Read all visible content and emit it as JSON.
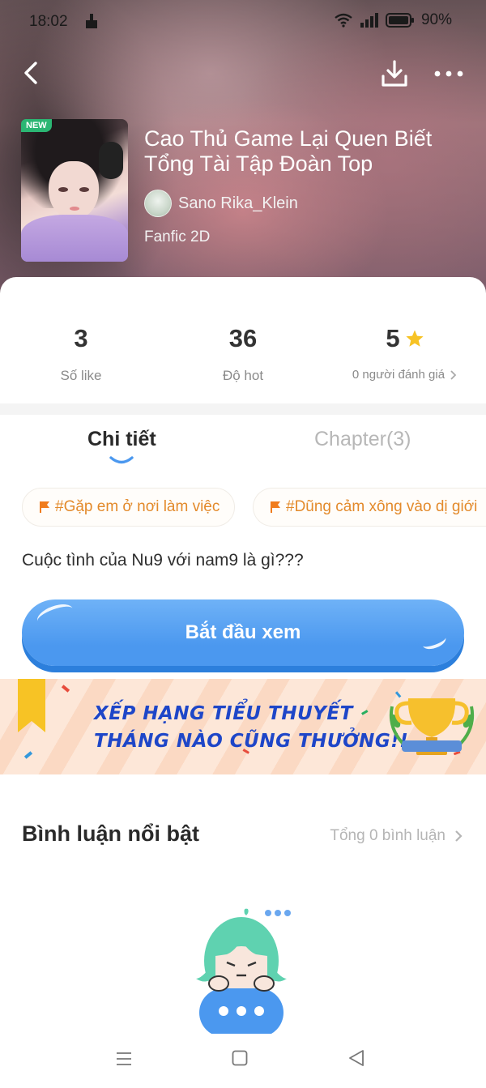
{
  "status_bar": {
    "time": "18:02",
    "battery": "90%"
  },
  "book": {
    "badge": "NEW",
    "title": "Cao Thủ Game Lại Quen Biết Tổng Tài Tập Đoàn Top",
    "author": "Sano Rika_Klein",
    "genre": "Fanfic 2D"
  },
  "stats": {
    "likes": {
      "value": "3",
      "label": "Số like"
    },
    "hot": {
      "value": "36",
      "label": "Độ hot"
    },
    "rating": {
      "value": "5",
      "label": "0 người đánh giá"
    }
  },
  "tabs": {
    "detail": "Chi tiết",
    "chapters": "Chapter(3)"
  },
  "tags": [
    "#Gặp em ở nơi làm việc",
    "#Dũng cảm xông vào dị giới"
  ],
  "description": "Cuộc tình của Nu9 với nam9 là gì???",
  "cta_label": "Bắt đầu xem",
  "banner": {
    "line1": "XẾP HẠNG TIỂU THUYẾT",
    "line2": "THÁNG NÀO CŨNG THƯỞNG!!"
  },
  "comments": {
    "title": "Bình luận nổi bật",
    "total": "Tổng 0 bình luận"
  },
  "colors": {
    "accent_blue": "#4b98ef",
    "tag_orange": "#e38a2b",
    "star": "#f7c325",
    "banner_text": "#1e46c8"
  },
  "icons": [
    "back-icon",
    "download-icon",
    "more-icon",
    "star-icon",
    "flag-icon",
    "chevron-right-icon",
    "menu-icon",
    "home-icon",
    "back-triangle-icon"
  ]
}
